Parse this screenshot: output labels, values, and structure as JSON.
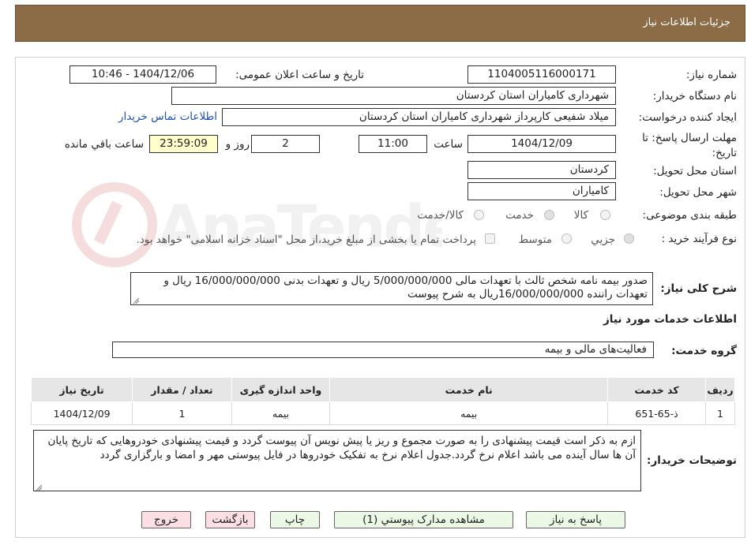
{
  "header": {
    "title": "جزئیات اطلاعات نیاز"
  },
  "form": {
    "need_number": {
      "label": "شماره نیاز:",
      "value": "1104005116000171"
    },
    "announce_datetime": {
      "label": "تاریخ و ساعت اعلان عمومی:",
      "value": "1404/12/06 - 10:46"
    },
    "buyer_org": {
      "label": "نام دستگاه خریدار:",
      "value": "شهرداری کامیاران استان کردستان"
    },
    "requester": {
      "label": "ایجاد کننده درخواست:",
      "value": "میلاد شفیعی کارپرداز شهرداری کامیاران استان کردستان",
      "contact_link": "اطلاعات تماس خریدار"
    },
    "deadline": {
      "label": "مهلت ارسال پاسخ: تا تاریخ:",
      "date": "1404/12/09",
      "time_label": "ساعت",
      "time": "11:00",
      "days": "2",
      "days_label": "روز و",
      "remaining": "23:59:09",
      "remaining_label": "ساعت باقي مانده"
    },
    "delivery_province": {
      "label": "استان محل تحویل:",
      "value": "کردستان"
    },
    "delivery_city": {
      "label": "شهر محل تحویل:",
      "value": "کامیاران"
    },
    "category": {
      "label": "طبقه بندی موضوعی:",
      "options": [
        "کالا",
        "خدمت",
        "کالا/خدمت"
      ],
      "selected": "خدمت"
    },
    "purchase_type": {
      "label": "نوع فرآیند خرید :",
      "options": [
        "جزیي",
        "متوسط"
      ],
      "selected": "جزیي",
      "treasury_note": "پرداخت تمام یا بخشی از مبلغ خرید،از محل \"اسناد خزانه اسلامی\" خواهد بود."
    },
    "general_description": {
      "label": "شرح کلی نیاز:",
      "value": "صدور بیمه نامه شخص ثالث  با تعهدات مالی 5/000/000/000 ریال و تعهدات بدنی 16/000/000/000 ریال و تعهدات راننده 16/000/000/000ریال به شرح  پیوست"
    }
  },
  "services_section": {
    "title": "اطلاعات خدمات مورد نیاز",
    "service_group_label": "گروه خدمت:",
    "service_group_value": "فعالیت‌های مالی و بیمه",
    "table": {
      "headers": [
        "ردیف",
        "کد خدمت",
        "نام خدمت",
        "واحد اندازه گیری",
        "تعداد / مقدار",
        "تاریخ نیاز"
      ],
      "rows": [
        [
          "1",
          "ذ-65-651",
          "بیمه",
          "بیمه",
          "1",
          "1404/12/09"
        ]
      ]
    }
  },
  "buyer_notes": {
    "label": "توضیحات خریدار:",
    "value": "ازم به ذکر است قیمت پیشنهادی را به صورت مجموع و ریز یا پیش نویس آن پیوست گردد و قیمت پیشنهادی خودروهایی که تاریخ پایان آن ها سال آینده می باشد  اعلام نرخ گردد.جدول اعلام نرخ به تفکیک خودروها در فایل پیوستی مهر و امضا و بارگزاری گردد"
  },
  "buttons": {
    "reply": "پاسخ به نیاز",
    "attachments": "مشاهده مدارک پیوستي (1)",
    "print": "چاپ",
    "back": "بازگشت",
    "exit": "خروج"
  },
  "colors": {
    "header_bg": "#8b6c46",
    "link": "#1f4fb5",
    "remaining_bg": "#ffffcc",
    "table_header_bg": "#e6e6e6",
    "green_button": "#ecf8e6",
    "red_button": "#fbdfe5"
  },
  "icons": {
    "watermark": "anatender-logo",
    "resize": "resize-grip-icon"
  }
}
